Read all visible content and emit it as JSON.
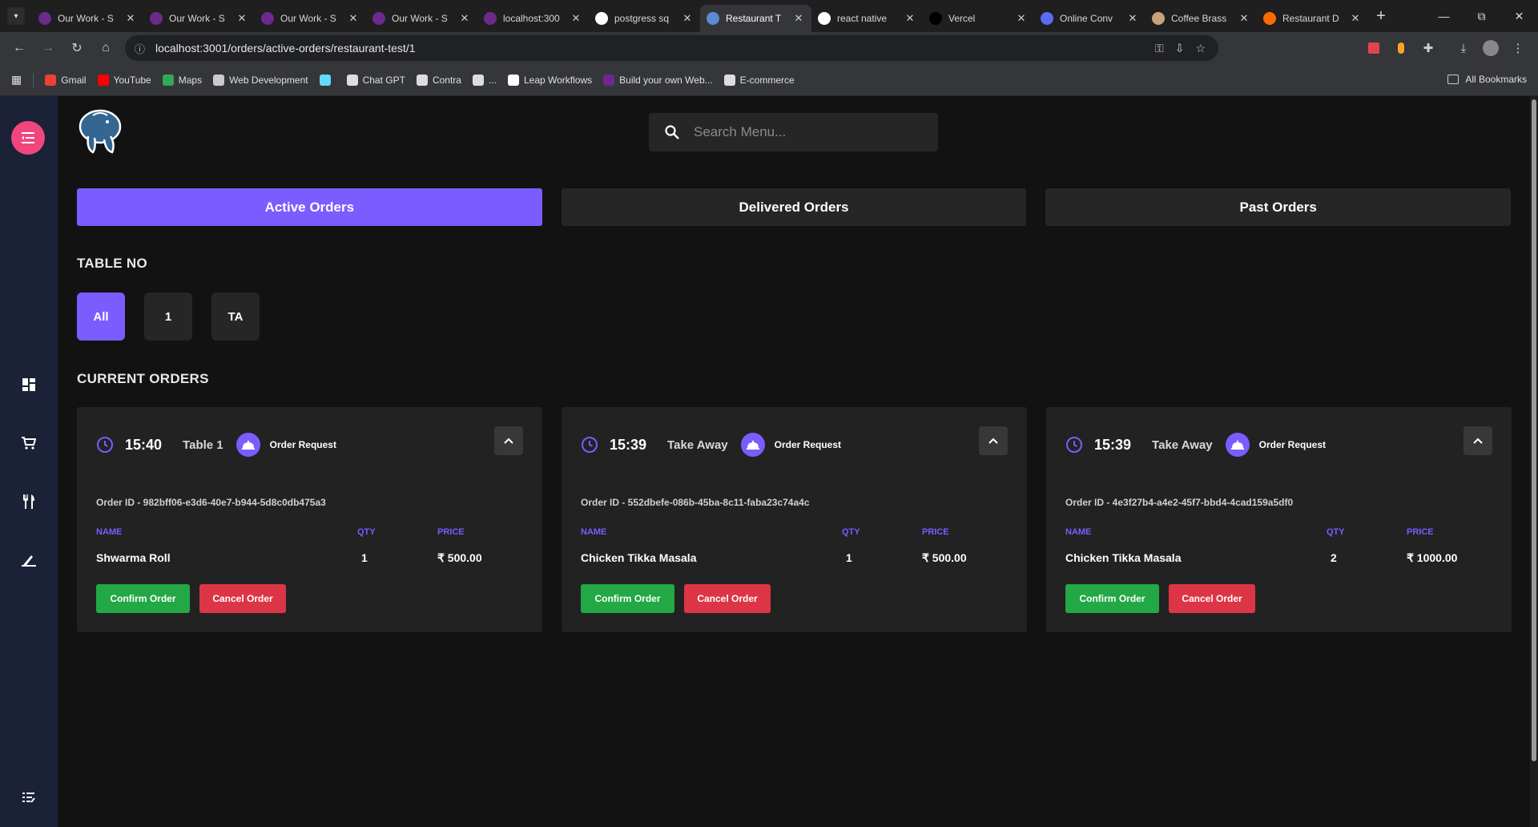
{
  "browser": {
    "tabs": [
      {
        "title": "Our Work - S",
        "icon": "studio-icon",
        "color": "#6b2a8c"
      },
      {
        "title": "Our Work - S",
        "icon": "studio-icon",
        "color": "#6b2a8c"
      },
      {
        "title": "Our Work - S",
        "icon": "studio-icon",
        "color": "#6b2a8c"
      },
      {
        "title": "Our Work - S",
        "icon": "studio-icon",
        "color": "#6b2a8c"
      },
      {
        "title": "localhost:300",
        "icon": "studio-icon",
        "color": "#6b2a8c"
      },
      {
        "title": "postgress sq",
        "icon": "google-icon",
        "color": "#ffffff"
      },
      {
        "title": "Restaurant T",
        "icon": "postgres-icon",
        "color": "#5b8bd0"
      },
      {
        "title": "react native",
        "icon": "google-icon",
        "color": "#ffffff"
      },
      {
        "title": "Vercel",
        "icon": "vercel-icon",
        "color": "#000000"
      },
      {
        "title": "Online Conv",
        "icon": "converter-icon",
        "color": "#5a6cf0"
      },
      {
        "title": "Coffee Brass",
        "icon": "coffee-icon",
        "color": "#c9a27a"
      },
      {
        "title": "Restaurant D",
        "icon": "flame-icon",
        "color": "#ff6a00"
      }
    ],
    "active_tab_index": 6,
    "url": "localhost:3001/orders/active-orders/restaurant-test/1",
    "bookmarks": [
      {
        "label": "Gmail",
        "icon": "gmail-icon",
        "color": "#ea4335"
      },
      {
        "label": "YouTube",
        "icon": "youtube-icon",
        "color": "#ff0000"
      },
      {
        "label": "Maps",
        "icon": "maps-icon",
        "color": "#34a853"
      },
      {
        "label": "Web Development",
        "icon": "folder-icon",
        "color": "#cccccc"
      },
      {
        "label": "",
        "icon": "react-icon",
        "color": "#61dafb"
      },
      {
        "label": "Chat GPT",
        "icon": "openai-icon",
        "color": "#dddddd"
      },
      {
        "label": "Contra",
        "icon": "contra-icon",
        "color": "#dddddd"
      },
      {
        "label": "...",
        "icon": "globe-icon",
        "color": "#dddddd"
      },
      {
        "label": "Leap Workflows",
        "icon": "leap-icon",
        "color": "#ffffff"
      },
      {
        "label": "Build your own Web...",
        "icon": "studio-icon",
        "color": "#6b2a8c"
      },
      {
        "label": "E-commerce",
        "icon": "openai-icon",
        "color": "#dddddd"
      }
    ],
    "all_bookmarks_label": "All Bookmarks"
  },
  "app": {
    "search_placeholder": "Search Menu...",
    "order_tabs": [
      "Active Orders",
      "Delivered Orders",
      "Past Orders"
    ],
    "active_order_tab": 0,
    "table_no_title": "TABLE NO",
    "tables": [
      "All",
      "1",
      "TA"
    ],
    "active_table": 0,
    "current_orders_title": "CURRENT ORDERS",
    "columns": {
      "name": "NAME",
      "qty": "QTY",
      "price": "PRICE"
    },
    "confirm_label": "Confirm Order",
    "cancel_label": "Cancel Order",
    "accent": "#7b5cff",
    "orders": [
      {
        "time": "15:40",
        "table": "Table 1",
        "status": "Order Request",
        "order_id": "Order ID - 982bff06-e3d6-40e7-b944-5d8c0db475a3",
        "item": "Shwarma Roll",
        "qty": "1",
        "price": "₹ 500.00"
      },
      {
        "time": "15:39",
        "table": "Take Away",
        "status": "Order Request",
        "order_id": "Order ID - 552dbefe-086b-45ba-8c11-faba23c74a4c",
        "item": "Chicken Tikka Masala",
        "qty": "1",
        "price": "₹ 500.00"
      },
      {
        "time": "15:39",
        "table": "Take Away",
        "status": "Order Request",
        "order_id": "Order ID - 4e3f27b4-a4e2-45f7-bbd4-4cad159a5df0",
        "item": "Chicken Tikka Masala",
        "qty": "2",
        "price": "₹ 1000.00"
      }
    ]
  }
}
